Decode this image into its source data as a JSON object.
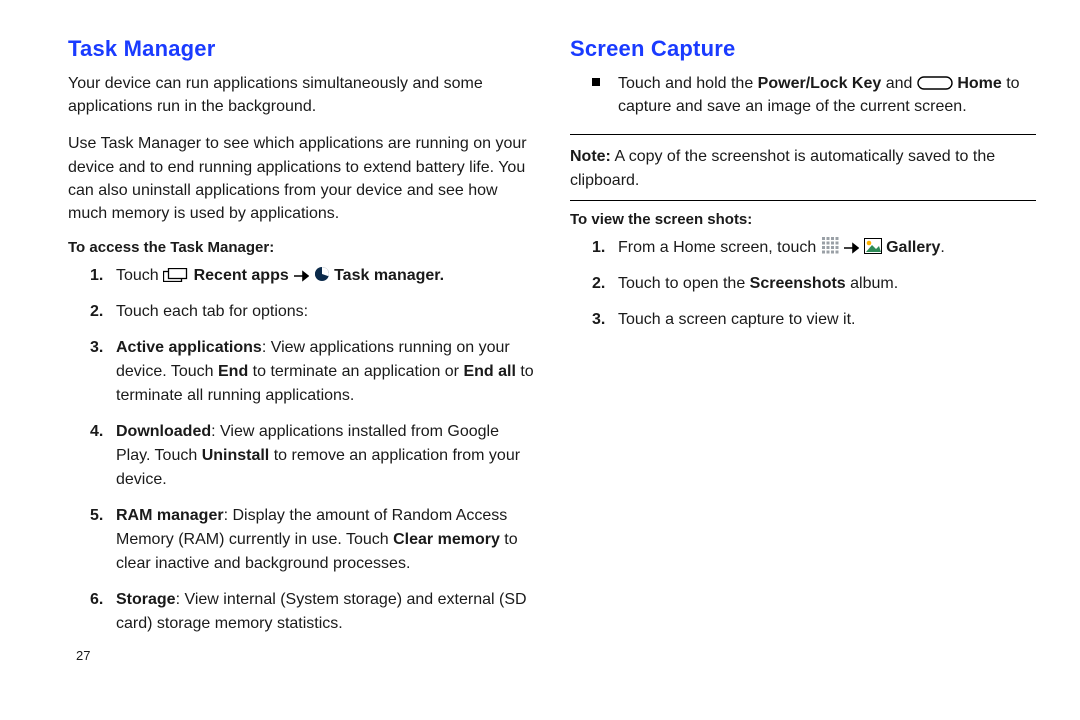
{
  "page_number": "27",
  "left": {
    "title": "Task Manager",
    "intro_1": "Your device can run applications simultaneously and some applications run in the background.",
    "intro_2": "Use Task Manager to see which applications are running on your device and to end running applications to extend battery life. You can also uninstall applications from your device and see how much memory is used by applications.",
    "subhead": "To access the Task Manager:",
    "steps": {
      "s1_a": "Touch ",
      "s1_b": " Recent apps ",
      "s1_c": " Task manager.",
      "s2": "Touch each tab for options:",
      "s3_a": "Active applications",
      "s3_b": ": View applications running on your device. Touch ",
      "s3_c": "End",
      "s3_d": " to terminate an application or ",
      "s3_e": "End all",
      "s3_f": " to terminate all running applications.",
      "s4_a": "Downloaded",
      "s4_b": ": View applications installed from Google Play. Touch ",
      "s4_c": "Uninstall",
      "s4_d": " to remove an application from your device.",
      "s5_a": "RAM manager",
      "s5_b": ": Display the amount of Random Access Memory (RAM) currently in use. Touch ",
      "s5_c": "Clear memory",
      "s5_d": " to clear inactive and background processes.",
      "s6_a": "Storage",
      "s6_b": ": View internal (System storage) and external (SD card) storage memory statistics."
    }
  },
  "right": {
    "title": "Screen Capture",
    "bullet_a": "Touch and hold the ",
    "bullet_b": "Power/Lock Key",
    "bullet_c": " and ",
    "bullet_d": " Home",
    "bullet_e": " to capture and save an image of the current screen.",
    "note_a": "Note:",
    "note_b": " A copy of the screenshot is automatically saved to the clipboard.",
    "subhead": "To view the screen shots:",
    "steps": {
      "s1_a": "From a Home screen, touch ",
      "s1_b": " Gallery",
      "s1_c": ".",
      "s2_a": "Touch to open the ",
      "s2_b": "Screenshots",
      "s2_c": " album.",
      "s3": "Touch a screen capture to view it."
    }
  },
  "icons": {
    "recent_apps": "recent-apps-icon",
    "arrow": "arrow-icon",
    "pie": "pie-icon",
    "home_key": "home-key-icon",
    "apps_grid": "apps-grid-icon",
    "gallery": "gallery-icon"
  }
}
